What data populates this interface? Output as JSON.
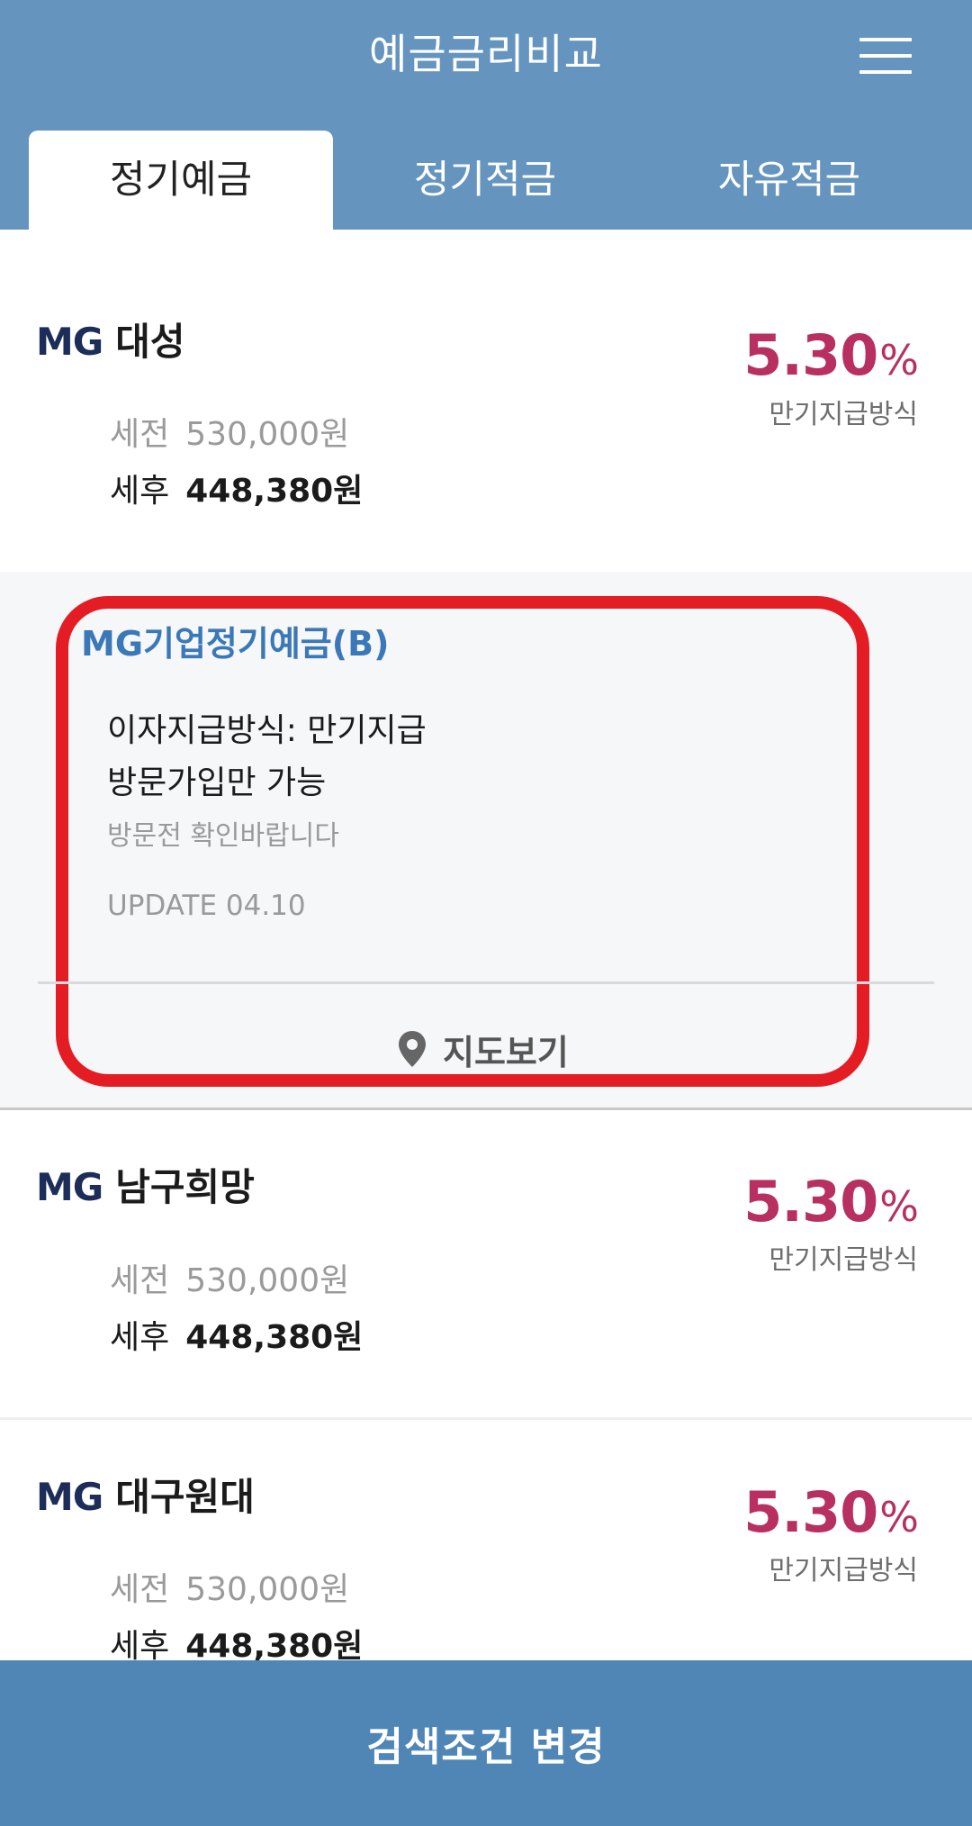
{
  "header": {
    "title": "예금금리비교",
    "tabs": [
      "정기예금",
      "정기적금",
      "자유적금"
    ],
    "active_tab": 0
  },
  "results": [
    {
      "prefix": "MG",
      "bank": "대성",
      "before_label": "세전",
      "before_value": "530,000원",
      "after_label": "세후",
      "after_value": "448,380원",
      "rate": "5.30",
      "rate_unit": "%",
      "method": "만기지급방식"
    },
    {
      "prefix": "MG",
      "bank": "남구희망",
      "before_label": "세전",
      "before_value": "530,000원",
      "after_label": "세후",
      "after_value": "448,380원",
      "rate": "5.30",
      "rate_unit": "%",
      "method": "만기지급방식"
    },
    {
      "prefix": "MG",
      "bank": "대구원대",
      "before_label": "세전",
      "before_value": "530,000원",
      "after_label": "세후",
      "after_value": "448,380원",
      "rate": "5.30",
      "rate_unit": "%",
      "method": "만기지급방식"
    }
  ],
  "detail": {
    "product_name": "MG기업정기예금(B)",
    "payment_method": "이자지급방식: 만기지급",
    "join_note": "방문가입만 가능",
    "visit_note": "방문전 확인바랍니다",
    "update": "UPDATE 04.10",
    "map_label": "지도보기"
  },
  "bottom_button": "검색조건 변경",
  "colors": {
    "header_bg": "#6595be",
    "rate": "#b8305f",
    "product_name": "#3a78b8",
    "highlight": "#e41c24",
    "bottom_bar": "#4f86b6"
  },
  "icons": {
    "menu": "hamburger-menu-icon",
    "map": "map-pin-icon"
  }
}
